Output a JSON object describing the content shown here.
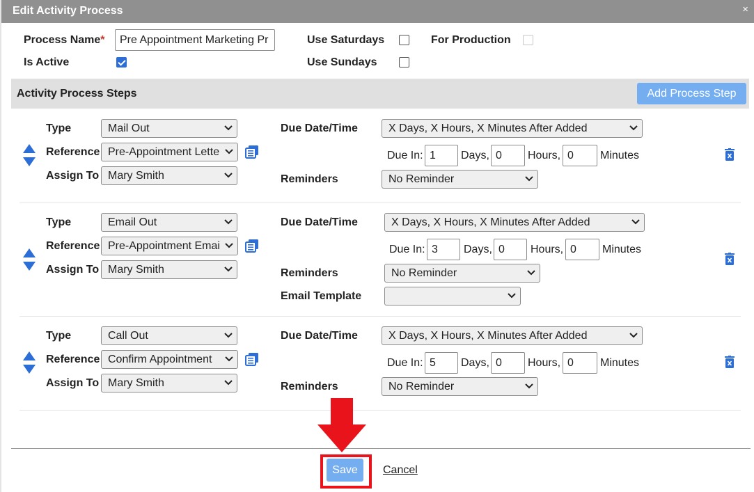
{
  "dialog": {
    "title": "Edit Activity Process",
    "close_glyph": "×"
  },
  "form": {
    "process_name_label": "Process Name",
    "required_mark": "*",
    "process_name_value": "Pre Appointment Marketing Pr",
    "is_active_label": "Is Active",
    "is_active_checked": true,
    "use_saturdays_label": "Use Saturdays",
    "use_saturdays_checked": false,
    "use_sundays_label": "Use Sundays",
    "use_sundays_checked": false,
    "for_production_label": "For Production",
    "for_production_checked": false
  },
  "steps_header": {
    "title": "Activity Process Steps",
    "add_button": "Add Process Step"
  },
  "labels": {
    "type": "Type",
    "reference": "Reference",
    "assign_to": "Assign To",
    "due_datetime": "Due Date/Time",
    "due_in": "Due In:",
    "days": "Days,",
    "hours": "Hours,",
    "minutes": "Minutes",
    "reminders": "Reminders",
    "email_template": "Email Template"
  },
  "steps": [
    {
      "type": "Mail Out",
      "reference": "Pre-Appointment Lette",
      "assign_to": "Mary Smith",
      "due_mode": "X Days, X Hours, X Minutes After Added",
      "days": "1",
      "hours": "0",
      "minutes": "0",
      "reminder": "No Reminder"
    },
    {
      "type": "Email Out",
      "reference": "Pre-Appointment Emai",
      "assign_to": "Mary Smith",
      "due_mode": "X Days, X Hours, X Minutes After Added",
      "days": "3",
      "hours": "0",
      "minutes": "0",
      "reminder": "No Reminder",
      "email_template": ""
    },
    {
      "type": "Call Out",
      "reference": "Confirm Appointment",
      "assign_to": "Mary Smith",
      "due_mode": "X Days, X Hours, X Minutes After Added",
      "days": "5",
      "hours": "0",
      "minutes": "0",
      "reminder": "No Reminder"
    }
  ],
  "footer": {
    "save": "Save",
    "cancel": "Cancel"
  },
  "colors": {
    "titlebar": "#909090",
    "accent_button": "#75aef0",
    "icon_blue": "#2c6ed5",
    "highlight_red": "#e8131b"
  }
}
